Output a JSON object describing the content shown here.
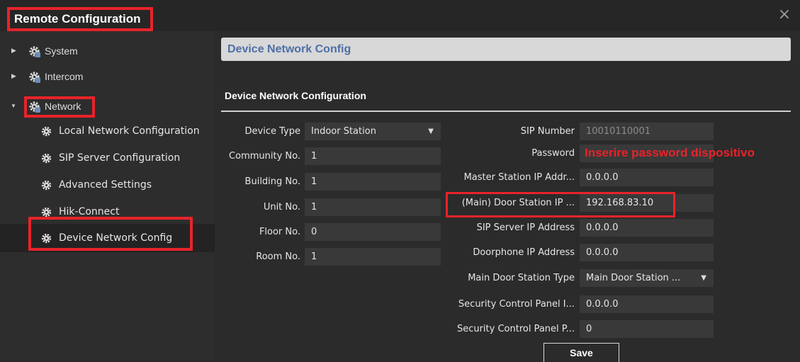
{
  "window": {
    "title": "Remote Configuration",
    "close_glyph": "×"
  },
  "sidebar": {
    "top_items": [
      {
        "label": "System",
        "icon": "gear-icon",
        "expanded": false
      },
      {
        "label": "Intercom",
        "icon": "gear-icon",
        "expanded": false
      },
      {
        "label": "Network",
        "icon": "gear-icon",
        "expanded": true
      }
    ],
    "sub_items": [
      {
        "label": "Local Network Configuration",
        "icon": "gear-icon"
      },
      {
        "label": "SIP Server Configuration",
        "icon": "gear-icon"
      },
      {
        "label": "Advanced Settings",
        "icon": "gear-icon"
      },
      {
        "label": "Hik-Connect",
        "icon": "gear-icon"
      },
      {
        "label": "Device Network Config",
        "icon": "gear-icon",
        "active": true
      }
    ],
    "arrows": {
      "collapsed": "▶",
      "expanded": "▼"
    }
  },
  "main": {
    "header": "Device Network Config",
    "section_title": "Device Network Configuration",
    "left_fields": [
      {
        "label": "Device Type",
        "value": "Indoor Station",
        "type": "select"
      },
      {
        "label": "Community No.",
        "value": "1"
      },
      {
        "label": "Building No.",
        "value": "1"
      },
      {
        "label": "Unit No.",
        "value": "1"
      },
      {
        "label": "Floor No.",
        "value": "0"
      },
      {
        "label": "Room No.",
        "value": "1"
      }
    ],
    "right_fields": [
      {
        "label": "SIP Number",
        "value": "10010110001",
        "disabled": true
      },
      {
        "label": "Password",
        "value": ""
      },
      {
        "label": "Master Station IP Addr...",
        "value": "0.0.0.0"
      },
      {
        "label": "(Main) Door Station IP ...",
        "value": "192.168.83.10"
      },
      {
        "label": "SIP Server IP Address",
        "value": "0.0.0.0"
      },
      {
        "label": "Doorphone IP Address",
        "value": "0.0.0.0"
      },
      {
        "label": "Main Door Station Type",
        "value": "Main Door Station ...",
        "type": "select"
      },
      {
        "label": "Security Control Panel I...",
        "value": "0.0.0.0"
      },
      {
        "label": "Security Control Panel P...",
        "value": "0"
      }
    ],
    "password_note": "Inserire password dispositivo",
    "save_label": "Save",
    "dropdown_caret": "▼"
  },
  "colors": {
    "highlight_red": "#e8232a",
    "header_text_blue": "#4d6fa5",
    "background": "#2b2b2b",
    "field_bg": "#393939"
  }
}
